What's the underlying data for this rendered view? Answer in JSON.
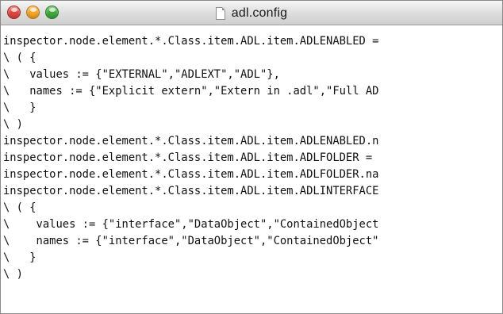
{
  "window": {
    "title": "adl.config",
    "buttons": {
      "close": "close-button",
      "minimize": "minimize-button",
      "zoom": "zoom-button"
    },
    "icon": "document-icon"
  },
  "editor": {
    "lines": [
      "inspector.node.element.*.Class.item.ADL.item.ADLENABLED =",
      "\\ ( {",
      "\\   values := {\"EXTERNAL\",\"ADLEXT\",\"ADL\"},",
      "\\   names := {\"Explicit extern\",\"Extern in .adl\",\"Full AD",
      "\\   }",
      "\\ )",
      "inspector.node.element.*.Class.item.ADL.item.ADLENABLED.n",
      "inspector.node.element.*.Class.item.ADL.item.ADLFOLDER =",
      "inspector.node.element.*.Class.item.ADL.item.ADLFOLDER.na",
      "inspector.node.element.*.Class.item.ADL.item.ADLINTERFACE",
      "\\ ( {",
      "\\    values := {\"interface\",\"DataObject\",\"ContainedObject",
      "\\    names := {\"interface\",\"DataObject\",\"ContainedObject\"",
      "\\   }",
      "\\ )"
    ]
  }
}
